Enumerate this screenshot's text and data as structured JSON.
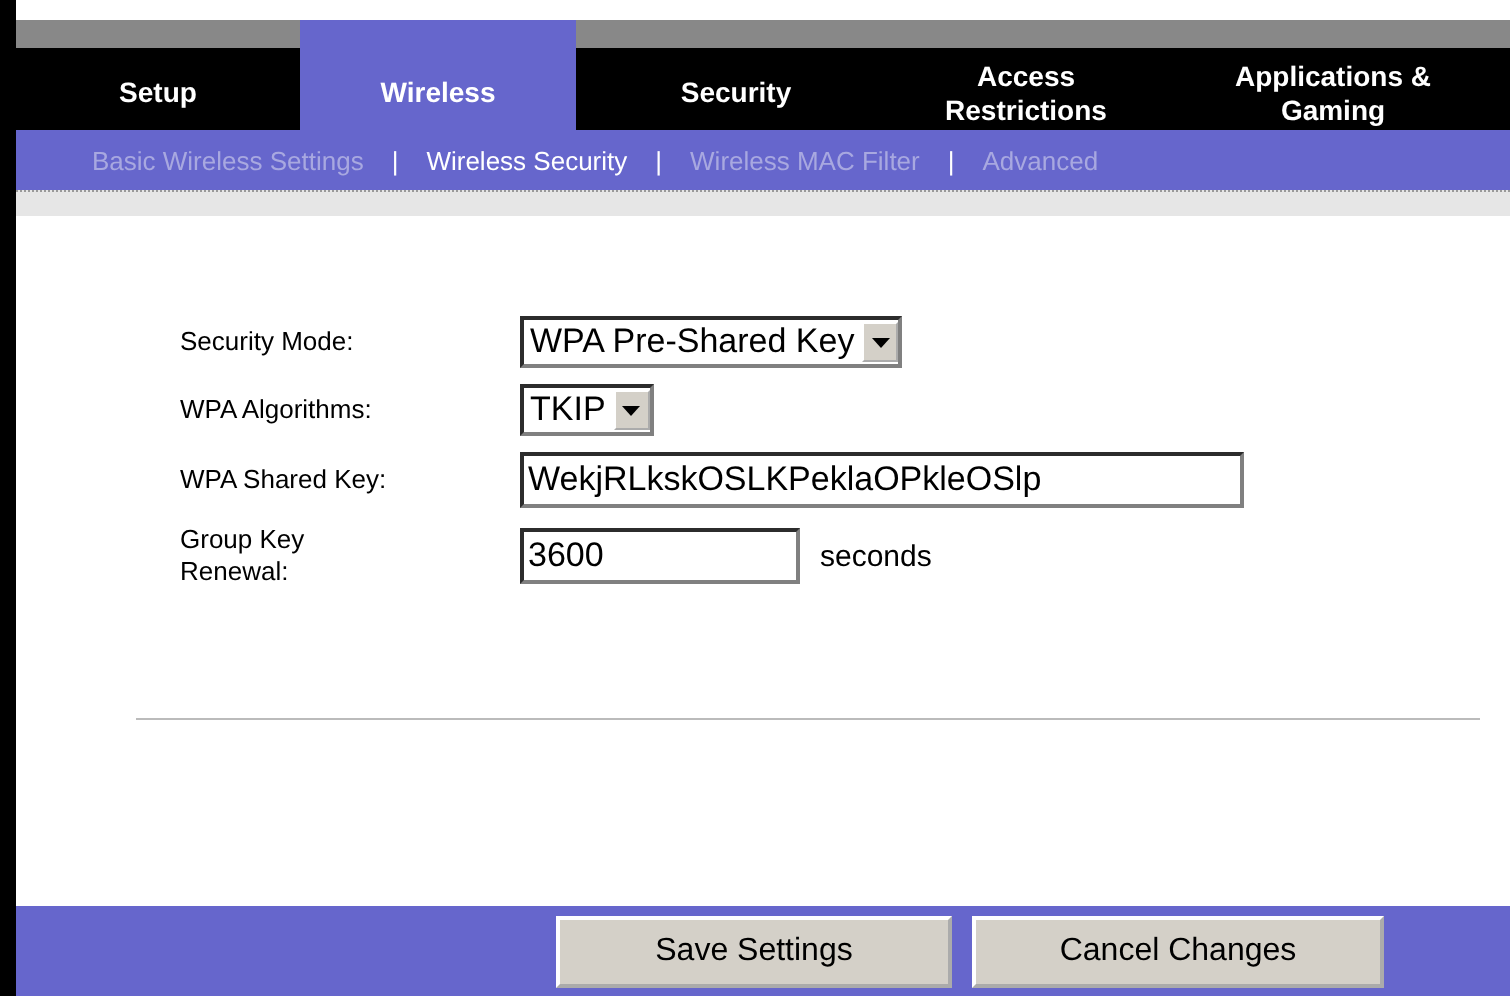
{
  "tabs": [
    {
      "label": "Setup",
      "selected": false
    },
    {
      "label": "Wireless",
      "selected": true
    },
    {
      "label": "Security",
      "selected": false
    },
    {
      "label": "Access Restrictions",
      "selected": false
    },
    {
      "label": "Applications & Gaming",
      "selected": false
    }
  ],
  "subtabs": [
    {
      "label": "Basic Wireless Settings",
      "selected": false
    },
    {
      "label": "Wireless Security",
      "selected": true
    },
    {
      "label": "Wireless MAC Filter",
      "selected": false
    },
    {
      "label": "Advanced",
      "selected": false
    }
  ],
  "separator": "|",
  "form": [
    {
      "kind": "select",
      "label": "Security Mode:",
      "value": "WPA Pre-Shared Key"
    },
    {
      "kind": "select",
      "label": "WPA Algorithms:",
      "value": "TKIP"
    },
    {
      "kind": "text",
      "label": "WPA Shared  Key:",
      "value": "WekjRLkskOSLKPeklaOPkleOSlp"
    },
    {
      "kind": "text",
      "label": "Group Key Renewal:",
      "value": "3600",
      "unit": "seconds"
    }
  ],
  "buttons": [
    "Save Settings",
    "Cancel Changes"
  ]
}
